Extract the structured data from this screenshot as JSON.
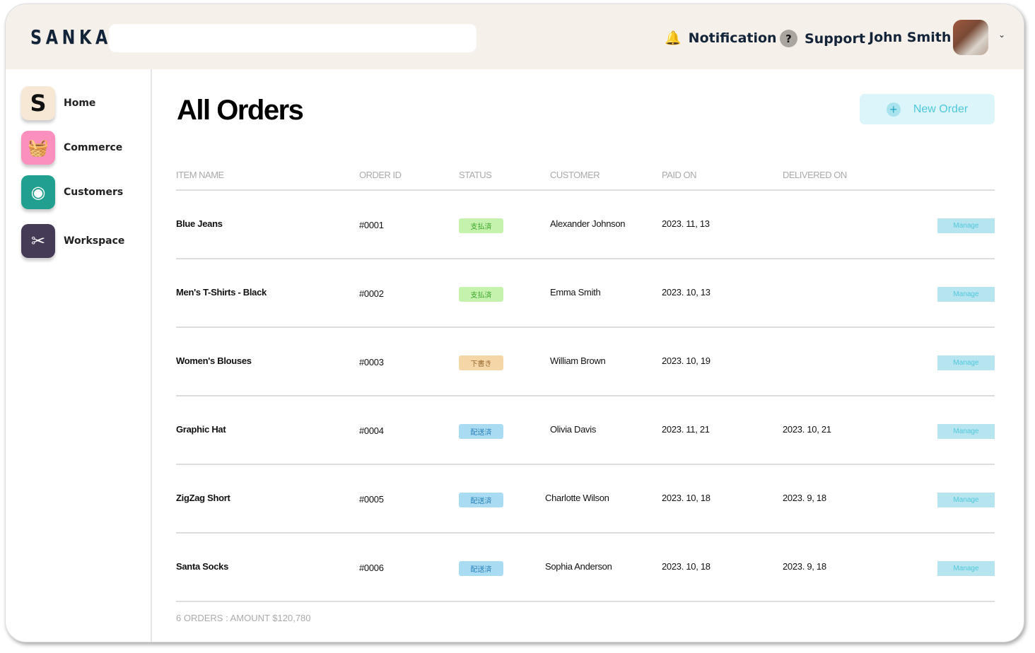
{
  "header": {
    "logo": "SANKA",
    "search_placeholder": "",
    "notification": "Notification",
    "support": "Support",
    "user": "John Smith"
  },
  "sidebar": {
    "items": [
      {
        "label": "Home",
        "color": "#f7e8d6"
      },
      {
        "label": "Commerce",
        "color": "#fb8fbd"
      },
      {
        "label": "Customers",
        "color": "#22a08f"
      },
      {
        "label": "Workspace",
        "color": "#463b57"
      }
    ]
  },
  "main": {
    "title": "All Orders",
    "new_order": "New Order",
    "columns": [
      "ITEM NAME",
      "ORDER ID",
      "STATUS",
      "CUSTOMER",
      "PAID ON",
      "DELIVERED ON"
    ],
    "manage_label": "Manage",
    "rows": [
      {
        "item": "Blue Jeans",
        "id": "#0001",
        "status": "支払済",
        "status_type": "paid",
        "customer": "Alexander Johnson",
        "paid": "2023. 11, 13",
        "delivered": ""
      },
      {
        "item": "Men's T-Shirts - Black",
        "id": "#0002",
        "status": "支払済",
        "status_type": "paid",
        "customer": "Emma Smith",
        "paid": "2023. 10, 13",
        "delivered": ""
      },
      {
        "item": "Women's Blouses",
        "id": "#0003",
        "status": "下書き",
        "status_type": "draft",
        "customer": "William Brown",
        "paid": "2023. 10, 19",
        "delivered": ""
      },
      {
        "item": "Graphic Hat",
        "id": "#0004",
        "status": "配送済",
        "status_type": "shipped",
        "customer": "Olivia Davis",
        "paid": "2023. 11, 21",
        "delivered": "2023. 10, 21"
      },
      {
        "item": "ZigZag Short",
        "id": "#0005",
        "status": "配送済",
        "status_type": "shipped",
        "customer": "Charlotte Wilson",
        "paid": "2023. 10, 18",
        "delivered": "2023. 9, 18"
      },
      {
        "item": "Santa Socks",
        "id": "#0006",
        "status": "配送済",
        "status_type": "shipped",
        "customer": "Sophia Anderson",
        "paid": "2023. 10, 18",
        "delivered": "2023. 9, 18"
      }
    ],
    "footer": "6 ORDERS : AMOUNT $120,780"
  },
  "status_colors": {
    "paid": {
      "bg": "#c5f2ad",
      "fg": "#3aa52a"
    },
    "draft": {
      "bg": "#f5d6a6",
      "fg": "#9a6a30"
    },
    "shipped": {
      "bg": "#a9dcf3",
      "fg": "#2a7fb8"
    }
  }
}
